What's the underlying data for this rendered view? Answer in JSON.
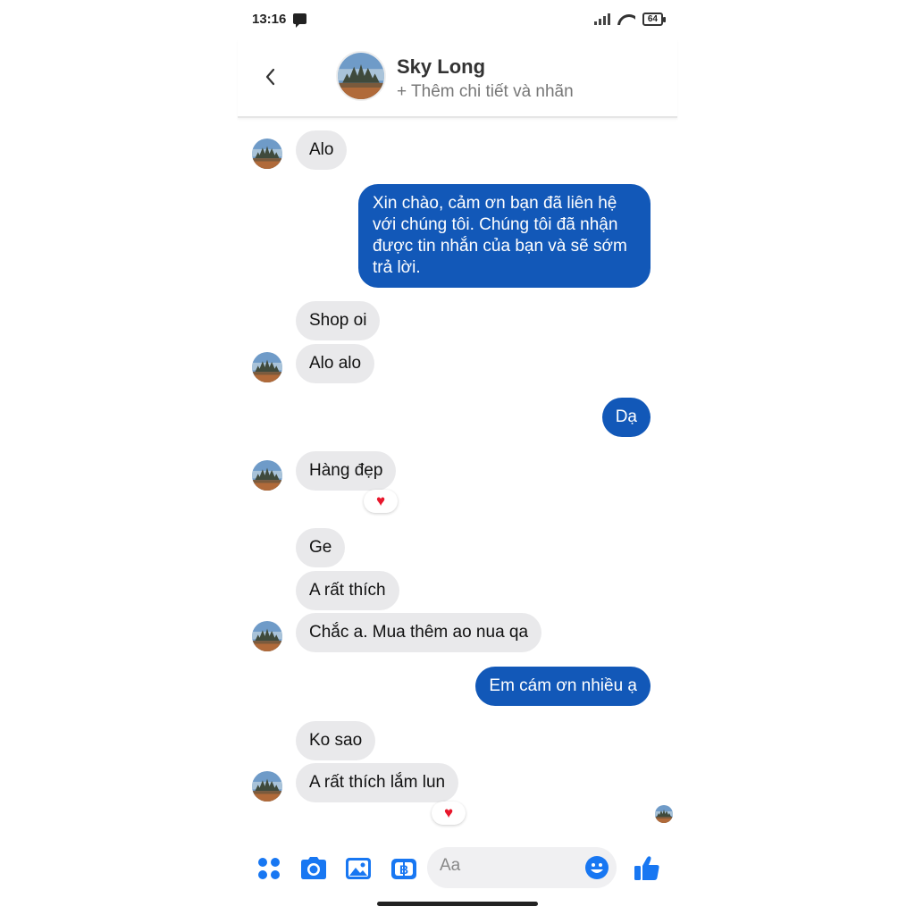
{
  "status_bar": {
    "time": "13:16",
    "battery": "64"
  },
  "header": {
    "contact_name": "Sky Long",
    "subtitle": "+ Thêm chi tiết và nhãn"
  },
  "messages": [
    {
      "sender": "contact",
      "text": "Alo"
    },
    {
      "sender": "me",
      "text": "Xin chào, cảm ơn bạn đã liên hệ với chúng tôi. Chúng tôi đã nhận được tin nhắn của bạn và sẽ sớm trả lời."
    },
    {
      "sender": "contact",
      "text": "Shop oi"
    },
    {
      "sender": "contact",
      "text": "Alo alo"
    },
    {
      "sender": "me",
      "text": "Dạ"
    },
    {
      "sender": "contact",
      "text": "Hàng đẹp",
      "reaction": "♥"
    },
    {
      "sender": "contact",
      "text": "Ge"
    },
    {
      "sender": "contact",
      "text": "A rất thích"
    },
    {
      "sender": "contact",
      "text": "Chắc a. Mua thêm ao nua qa"
    },
    {
      "sender": "me",
      "text": "Em cám ơn nhiều ạ"
    },
    {
      "sender": "contact",
      "text": "Ko sao"
    },
    {
      "sender": "contact",
      "text": "A rất thích lắm lun",
      "reaction": "♥"
    }
  ],
  "composer": {
    "placeholder": "Aa",
    "icons": [
      "apps-icon",
      "camera-icon",
      "gallery-icon",
      "payment-icon",
      "emoji-icon",
      "like-icon"
    ]
  },
  "colors": {
    "accent": "#1877f2",
    "outgoing_bubble": "#1258b8",
    "incoming_bubble": "#e9e9eb",
    "reaction": "#e8172c"
  }
}
